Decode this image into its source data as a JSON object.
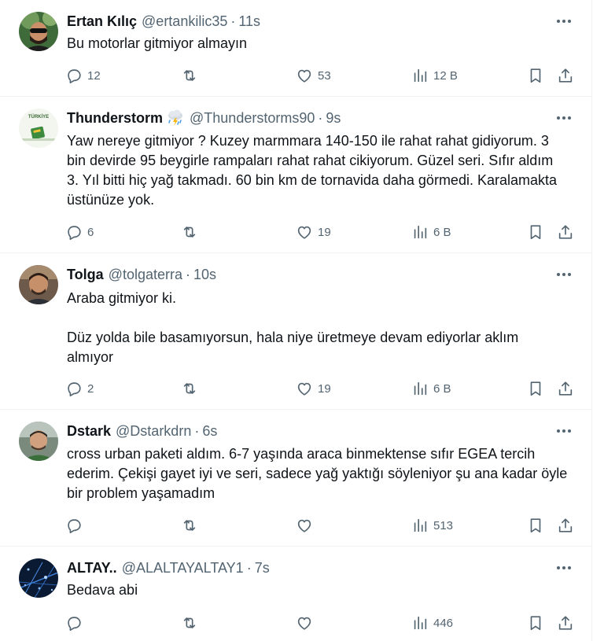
{
  "tweets": [
    {
      "name": "Ertan Kılıç",
      "handle": "@ertankilic35",
      "time": "11s",
      "text": [
        "Bu motorlar gitmiyor almayın"
      ],
      "replies": "12",
      "retweets": "",
      "likes": "53",
      "views": "12 B"
    },
    {
      "name": "Thunderstorm",
      "handle": "@Thunderstorms90",
      "time": "9s",
      "badge_icon": "thunderstorm-cloud-emoji",
      "avatar_text": "TÜRKİYE",
      "text": [
        "Yaw nereye gitmiyor ? Kuzey marmmara 140-150 ile rahat rahat gidiyorum. 3 bin devirde 95 beygirle rampaları rahat rahat cikiyorum. Güzel seri. Sıfır aldım 3. Yıl bitti hiç yağ takmadı. 60 bin km de tornavida daha görmedi. Karalamakta üstünüze yok."
      ],
      "replies": "6",
      "retweets": "",
      "likes": "19",
      "views": "6 B"
    },
    {
      "name": "Tolga",
      "handle": "@tolgaterra",
      "time": "10s",
      "text": [
        "Araba gitmiyor ki.",
        "",
        "Düz yolda bile basamıyorsun, hala niye üretmeye devam ediyorlar aklım almıyor"
      ],
      "replies": "2",
      "retweets": "",
      "likes": "19",
      "views": "6 B"
    },
    {
      "name": "Dstark",
      "handle": "@Dstarkdrn",
      "time": "6s",
      "text": [
        "cross urban paketi aldım. 6-7 yaşında araca binmektense sıfır EGEA tercih ederim. Çekişi gayet iyi ve seri, sadece yağ yaktığı söyleniyor şu ana kadar öyle bir problem yaşamadım"
      ],
      "replies": "",
      "retweets": "",
      "likes": "",
      "views": "513"
    },
    {
      "name": "ALTAY..",
      "handle": "@ALALTAYALTAY1",
      "time": "7s",
      "text": [
        "Bedava abi"
      ],
      "replies": "",
      "retweets": "",
      "likes": "",
      "views": "446"
    }
  ],
  "icons": {
    "reply": "reply-icon",
    "retweet": "retweet-icon",
    "like": "like-icon",
    "views": "views-icon",
    "bookmark": "bookmark-icon",
    "share": "share-icon",
    "more": "more-icon"
  },
  "colors": {
    "text": "#0f1419",
    "secondary": "#536471",
    "divider": "#eff3f4"
  }
}
